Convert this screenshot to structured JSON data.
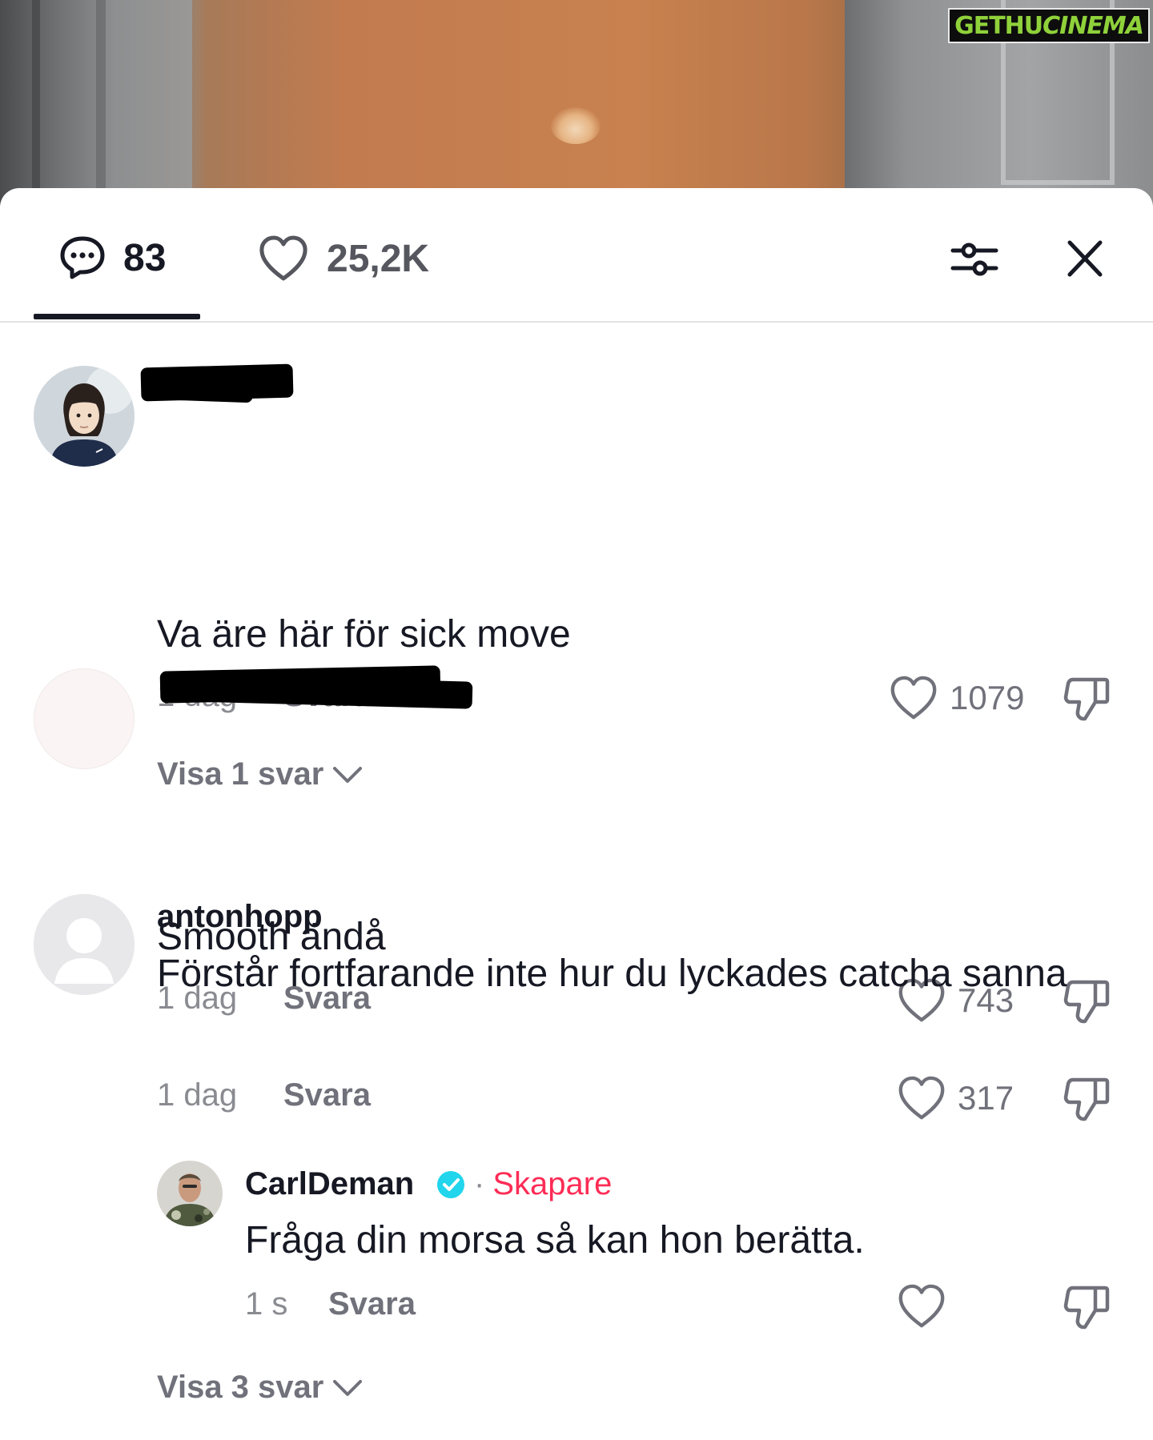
{
  "watermark": {
    "part1": "GETHU",
    "part2": "CINEMA"
  },
  "sheet": {
    "tabs": {
      "comments_count": "83",
      "likes_count": "25,2K"
    },
    "icons": {
      "comments": "comment-bubble-icon",
      "likes": "heart-icon",
      "filter": "filter-sliders-icon",
      "close": "close-icon"
    }
  },
  "comments": [
    {
      "username": "",
      "text": "Va äre här för sick move",
      "time": "1 dag",
      "reply_label": "Svara",
      "likes": "1079",
      "view_replies": "Visa 1 svar"
    },
    {
      "username": "",
      "text": "Smooth ändå",
      "time": "1 dag",
      "reply_label": "Svara",
      "likes": "743"
    },
    {
      "username": "antonhopp",
      "text": "Förstår fortfarande inte hur du lyckades catcha sanna",
      "time": "1 dag",
      "reply_label": "Svara",
      "likes": "317",
      "reply": {
        "username": "CarlDeman",
        "role": "Skapare",
        "separator": "·",
        "text": "Fråga din morsa så kan hon berätta.",
        "time": "1 s",
        "reply_label": "Svara",
        "likes": ""
      },
      "view_replies": "Visa 3 svar"
    }
  ],
  "colors": {
    "primary_text": "#161823",
    "secondary_text": "#70717a",
    "accent_creator": "#fe2c55",
    "verified": "#20d5ec"
  }
}
